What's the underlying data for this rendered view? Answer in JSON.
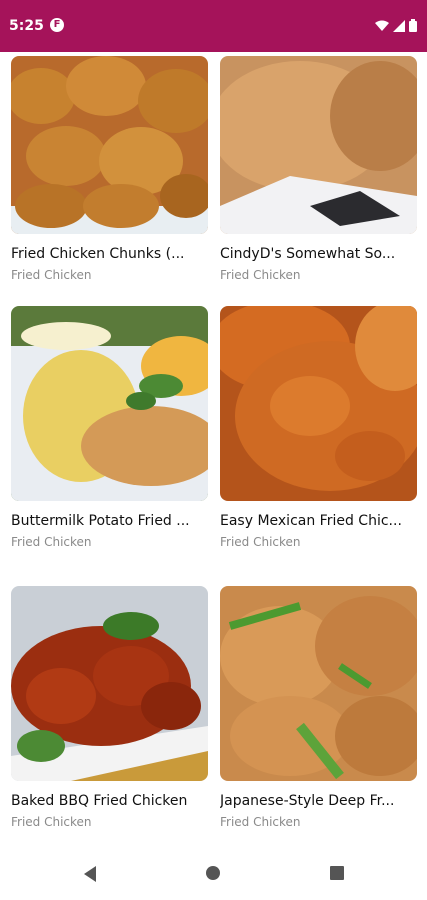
{
  "status": {
    "time": "5:25",
    "app_badge": "F"
  },
  "recipes": [
    {
      "title": "Fried Chicken Chunks (...",
      "category": "Fried Chicken"
    },
    {
      "title": "CindyD's Somewhat So...",
      "category": "Fried Chicken"
    },
    {
      "title": "Buttermilk Potato Fried ...",
      "category": "Fried Chicken"
    },
    {
      "title": "Easy Mexican Fried Chic...",
      "category": "Fried Chicken"
    },
    {
      "title": "Baked BBQ Fried Chicken",
      "category": "Fried Chicken"
    },
    {
      "title": "Japanese-Style Deep Fr...",
      "category": "Fried Chicken"
    }
  ],
  "colors": {
    "status_bar": "#a5135a",
    "title": "#111111",
    "subtitle": "#8a8a8a"
  },
  "icons": {
    "back": "triangle-left",
    "home": "circle",
    "recents": "square"
  }
}
